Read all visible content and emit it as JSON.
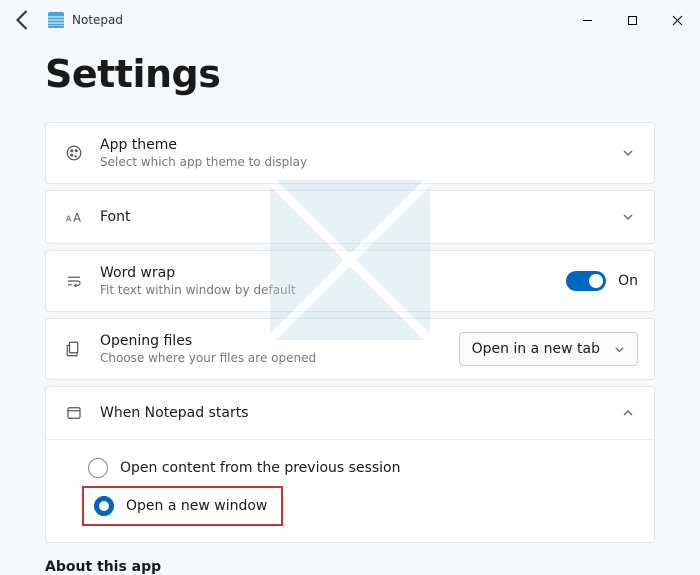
{
  "titlebar": {
    "app_name": "Notepad"
  },
  "page": {
    "title": "Settings",
    "about_heading": "About this app"
  },
  "settings": {
    "theme": {
      "label": "App theme",
      "sub": "Select which app theme to display"
    },
    "font": {
      "label": "Font"
    },
    "wrap": {
      "label": "Word wrap",
      "sub": "Fit text within window by default",
      "state": "On"
    },
    "openfiles": {
      "label": "Opening files",
      "sub": "Choose where your files are opened",
      "value": "Open in a new tab"
    },
    "startup": {
      "label": "When Notepad starts",
      "options": {
        "prev": "Open content from the previous session",
        "newwin": "Open a new window"
      },
      "selected": "newwin"
    }
  }
}
